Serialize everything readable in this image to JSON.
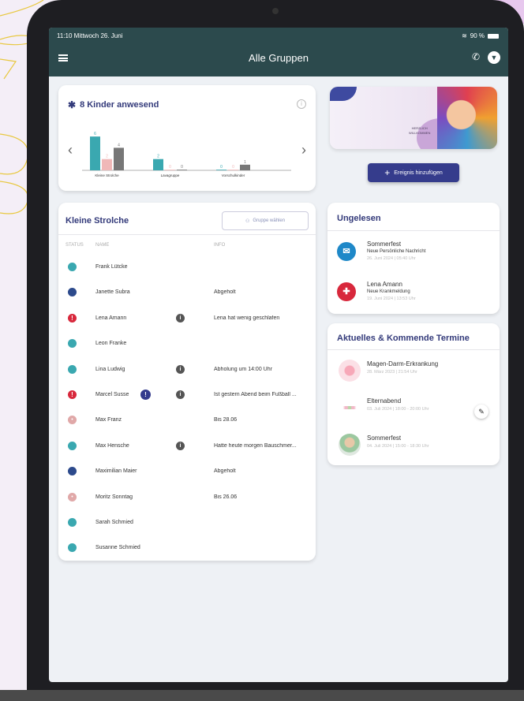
{
  "status_bar": {
    "time": "11:10",
    "date": "Mittwoch 26. Juni",
    "battery": "90 %"
  },
  "header": {
    "title": "Alle Gruppen",
    "menu_icon": "hamburger-menu-icon",
    "phone_icon": "phone-icon",
    "profile_icon": "profile-icon"
  },
  "kids_card": {
    "title": "8 Kinder anwesend",
    "chart_data": {
      "type": "bar",
      "categories": [
        "Kleine Strolche",
        "Lavagruppe",
        "Vorschulkinder"
      ],
      "series": [
        {
          "values": [
            6,
            2,
            0
          ],
          "color": "#3aa8b0"
        },
        {
          "values": [
            2,
            0,
            0
          ],
          "color": "#f0b8b8"
        },
        {
          "values": [
            4,
            0,
            1
          ],
          "color": "#777777"
        }
      ],
      "data_labels": [
        [
          "6",
          "2",
          "4"
        ],
        [
          "2",
          "0",
          "0"
        ],
        [
          "0",
          "0",
          "1"
        ]
      ],
      "ylim": [
        0,
        7
      ]
    }
  },
  "banner": {
    "text_line1": "HERZLICH",
    "text_line2": "WILLKOMMEN"
  },
  "add_event_label": "Ereignis hinzufügen",
  "group": {
    "title": "Kleine Strolche",
    "select_label": "Gruppe wählen",
    "columns": {
      "status": "STATUS",
      "name": "NAME",
      "info": "INFO"
    },
    "rows": [
      {
        "status": "present",
        "name": "Frank Lütcke",
        "info": ""
      },
      {
        "status": "picked-up",
        "name": "Janette Subra",
        "info": "Abgeholt"
      },
      {
        "status": "alert",
        "name": "Lena Amann",
        "info": "Lena hat wenig geschlafen"
      },
      {
        "status": "present",
        "name": "Leon Franke",
        "info": ""
      },
      {
        "status": "present",
        "name": "Lina Ludwig",
        "info": "Abholung um 14:00 Uhr"
      },
      {
        "status": "alert",
        "name": "Marcel Susse",
        "info": "Ist gestern Abend beim Fußball ..."
      },
      {
        "status": "absent",
        "name": "Max Franz",
        "info": "Bis 28.06"
      },
      {
        "status": "present",
        "name": "Max Hensche",
        "info": "Hatte heute morgen Bauschmer..."
      },
      {
        "status": "picked-up",
        "name": "Maximilian Maier",
        "info": "Abgeholt"
      },
      {
        "status": "absent",
        "name": "Moritz Sonntag",
        "info": "Bis 26.06"
      },
      {
        "status": "present",
        "name": "Sarah Schmied",
        "info": ""
      },
      {
        "status": "present",
        "name": "Susanne Schmied",
        "info": ""
      }
    ]
  },
  "unread": {
    "title": "Ungelesen",
    "messages": [
      {
        "title": "Sommerfest",
        "subtitle": "Neue Persönliche Nachricht",
        "date": "26. Juni 2024 | 05:40 Uhr",
        "icon": "mail-icon",
        "icon_glyph": "✉"
      },
      {
        "title": "Lena Amann",
        "subtitle": "Neue Krankmeldung",
        "date": "19. Juni 2024 | 13:53 Uhr",
        "icon": "medical-cross-icon",
        "icon_glyph": "✚"
      }
    ]
  },
  "upcoming": {
    "title": "Aktuelles & Kommende Termine",
    "events": [
      {
        "title": "Magen-Darm-Erkrankung",
        "date": "28. März 2023 | 21:54 Uhr"
      },
      {
        "title": "Elternabend",
        "date": "03. Juli 2024 | 18:00 - 20:00 Uhr"
      },
      {
        "title": "Sommerfest",
        "date": "04. Juli 2024 | 15:00 - 18:30 Uhr"
      }
    ]
  },
  "colors": {
    "header_bg": "#2c4a4d",
    "accent": "#333a7a",
    "button": "#353c8c",
    "present": "#3aa8b0",
    "picked_up": "#2c4a8c",
    "alert": "#d8283c",
    "absent": "#e0a8a8"
  }
}
